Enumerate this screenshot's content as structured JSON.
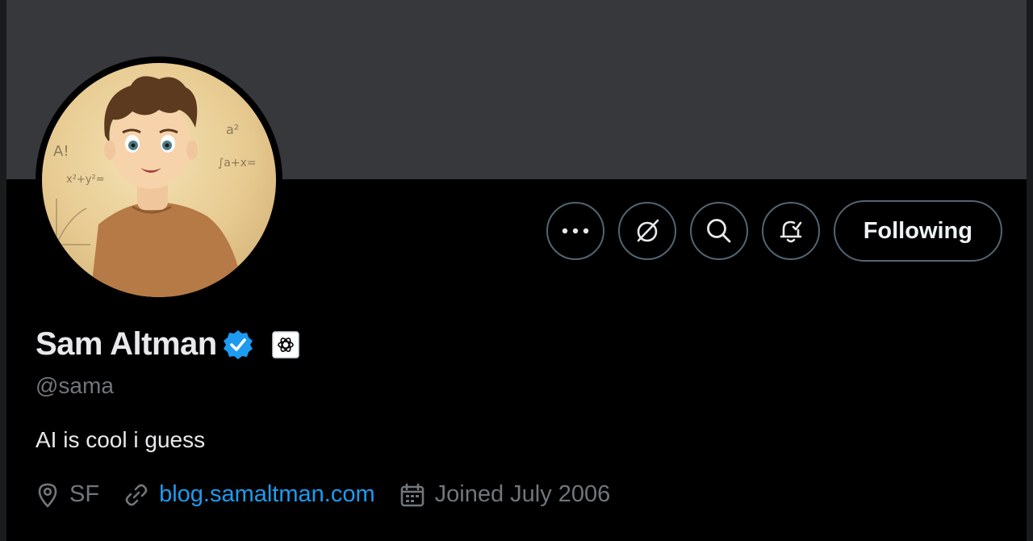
{
  "profile": {
    "name": "Sam Altman",
    "handle": "@sama",
    "bio": "AI is cool i guess",
    "location": "SF",
    "website": "blog.samaltman.com",
    "joined": "Joined July 2006",
    "verified": true
  },
  "actions": {
    "more_icon": "more-icon",
    "grok_icon": "grok-icon",
    "search_icon": "search-icon",
    "notify_icon": "notification-bell-icon",
    "follow_label": "Following"
  },
  "avatar_doodles": {
    "t1": "A!",
    "t2": "x²+y²=",
    "t3": "a²",
    "t4": "∫a+x="
  },
  "colors": {
    "banner": "#37383c",
    "accent": "#1d9bf0",
    "secondary_text": "#71767b",
    "button_border": "#536471"
  }
}
